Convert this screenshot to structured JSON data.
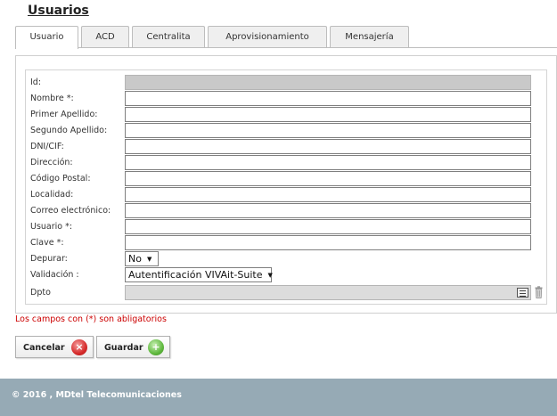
{
  "page": {
    "title": "Usuarios"
  },
  "tabs": [
    {
      "label": "Usuario",
      "active": true
    },
    {
      "label": "ACD"
    },
    {
      "label": "Centralita"
    },
    {
      "label": "Aprovisionamiento"
    },
    {
      "label": "Mensajería"
    }
  ],
  "form": {
    "id": {
      "label": "Id:",
      "value": ""
    },
    "nombre": {
      "label": "Nombre *:",
      "value": ""
    },
    "primer_apellido": {
      "label": "Primer Apellido:",
      "value": ""
    },
    "segundo_apellido": {
      "label": "Segundo Apellido:",
      "value": ""
    },
    "dni": {
      "label": "DNI/CIF:",
      "value": ""
    },
    "direccion": {
      "label": "Dirección:",
      "value": ""
    },
    "codigo_postal": {
      "label": "Código Postal:",
      "value": ""
    },
    "localidad": {
      "label": "Localidad:",
      "value": ""
    },
    "correo": {
      "label": "Correo electrónico:",
      "value": ""
    },
    "usuario": {
      "label": "Usuario *:",
      "value": ""
    },
    "clave": {
      "label": "Clave *:",
      "value": ""
    },
    "depurar": {
      "label": "Depurar:",
      "selected": "No"
    },
    "validacion": {
      "label": "Validación :",
      "selected": "Autentificación VIVAit-Suite"
    },
    "dpto": {
      "label": "Dpto",
      "value": ""
    }
  },
  "required_note": "Los campos con (*) son abligatorios",
  "buttons": {
    "cancel": "Cancelar",
    "save": "Guardar"
  },
  "icons": {
    "cancel": "close-icon",
    "save": "plus-icon",
    "dpto_list": "list-icon",
    "dpto_delete": "trash-icon"
  },
  "colors": {
    "footer": "#96aab5",
    "required_note": "#cc0000",
    "readonly_field": "#c9c9c9"
  },
  "footer": {
    "text": "© 2016 , MDtel Telecomunicaciones"
  }
}
